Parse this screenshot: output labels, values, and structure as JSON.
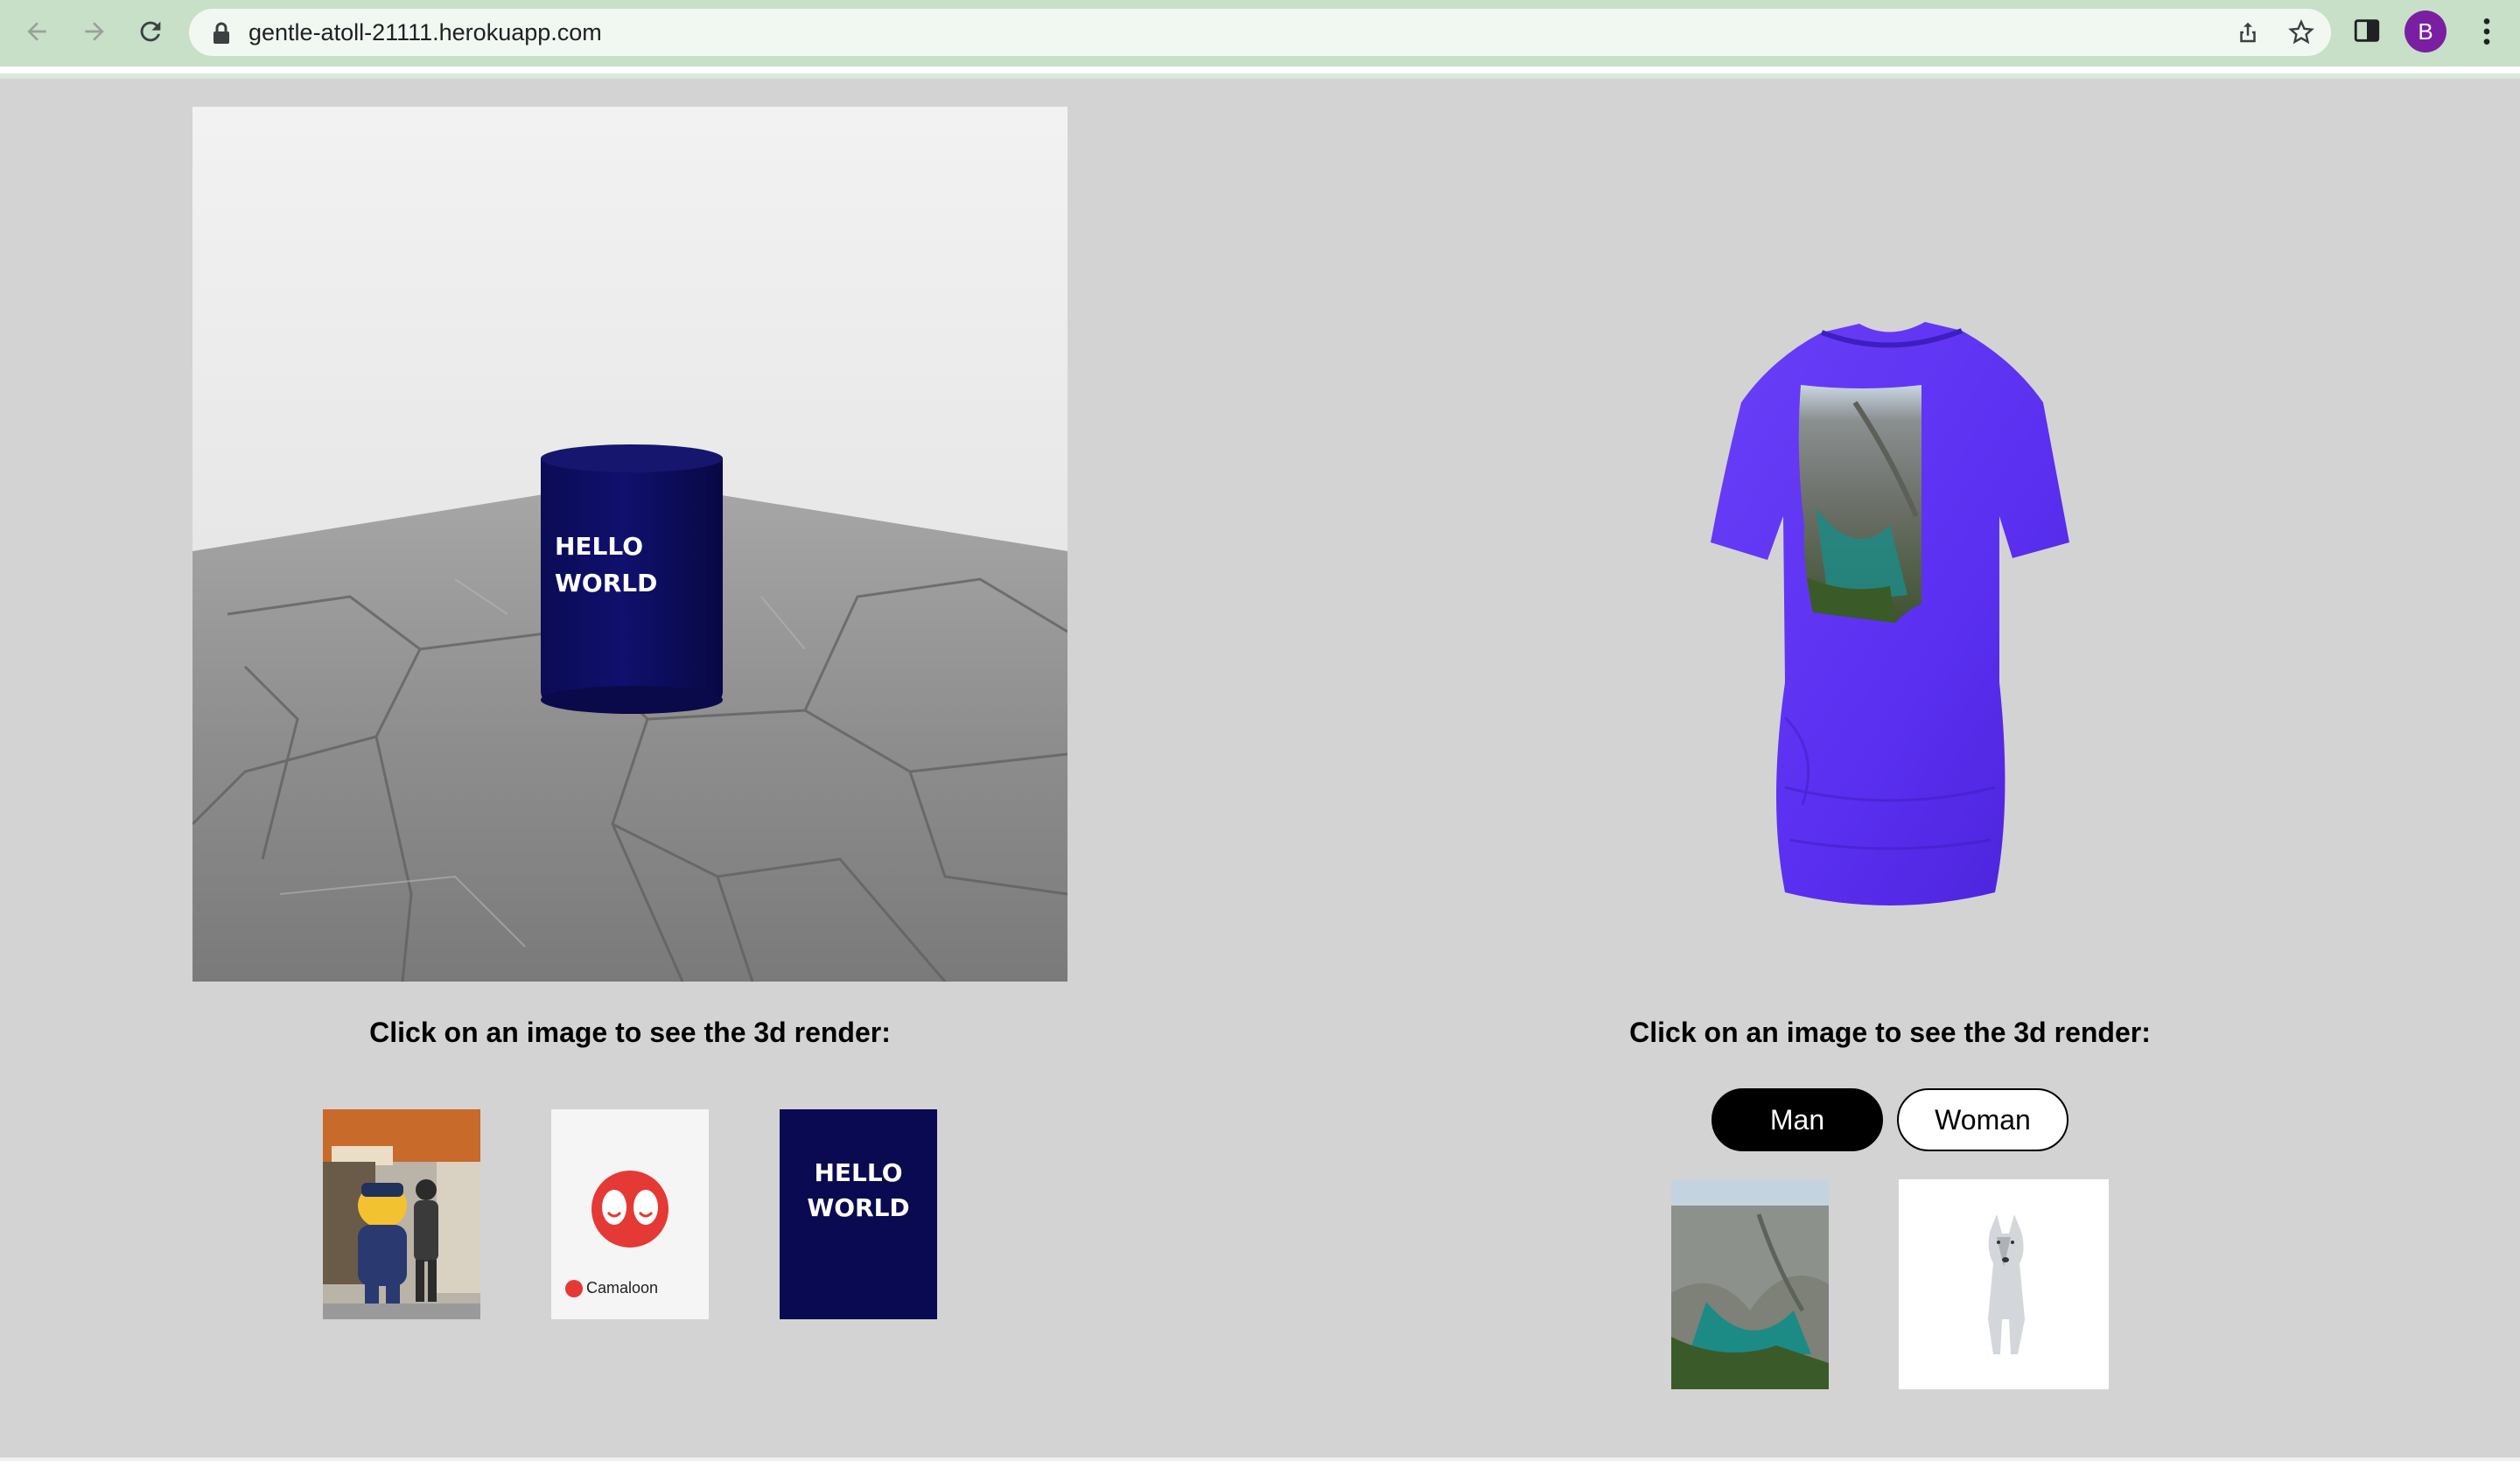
{
  "browser": {
    "url": "gentle-atoll-21111.herokuapp.com",
    "profile_initial": "B",
    "icons": [
      "back-arrow-icon",
      "forward-arrow-icon",
      "reload-icon",
      "lock-icon",
      "share-icon",
      "star-icon",
      "side-panel-icon",
      "kebab-menu-icon"
    ]
  },
  "left_panel": {
    "scene_text_line1": "HELLO",
    "scene_text_line2": "WORLD",
    "caption": "Click on an image to see the 3d render:",
    "thumbnails": [
      {
        "name": "police-mascot-photo"
      },
      {
        "name": "camaloon-logo",
        "brand_text": "Camaloon"
      },
      {
        "name": "hello-world-design",
        "line1": "HELLO",
        "line2": "WORLD"
      }
    ]
  },
  "right_panel": {
    "caption": "Click on an image to see the 3d render:",
    "gender_options": [
      "Man",
      "Woman"
    ],
    "selected_gender": "Man",
    "thumbnails": [
      {
        "name": "canyon-photo"
      },
      {
        "name": "wolf-photo"
      }
    ]
  },
  "colors": {
    "page_bg": "#d3d3d3",
    "can_color": "#0a0a5e",
    "shirt_color": "#5a2ff0",
    "button_selected": "#000000"
  }
}
